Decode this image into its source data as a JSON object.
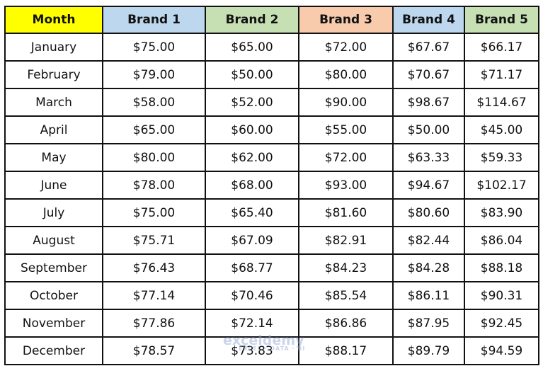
{
  "colors": {
    "month_header": "#ffff00",
    "brand1": "#bdd7ee",
    "brand2": "#c6e0b4",
    "brand3": "#f8cbad",
    "brand4": "#bdd7ee",
    "brand5": "#c6e0b4"
  },
  "headers": [
    "Month",
    "Brand 1",
    "Brand 2",
    "Brand 3",
    "Brand 4",
    "Brand 5"
  ],
  "rows": [
    [
      "January",
      "$75.00",
      "$65.00",
      "$72.00",
      "$67.67",
      "$66.17"
    ],
    [
      "February",
      "$79.00",
      "$50.00",
      "$80.00",
      "$70.67",
      "$71.17"
    ],
    [
      "March",
      "$58.00",
      "$52.00",
      "$90.00",
      "$98.67",
      "$114.67"
    ],
    [
      "April",
      "$65.00",
      "$60.00",
      "$55.00",
      "$50.00",
      "$45.00"
    ],
    [
      "May",
      "$80.00",
      "$62.00",
      "$72.00",
      "$63.33",
      "$59.33"
    ],
    [
      "June",
      "$78.00",
      "$68.00",
      "$93.00",
      "$94.67",
      "$102.17"
    ],
    [
      "July",
      "$75.00",
      "$65.40",
      "$81.60",
      "$80.60",
      "$83.90"
    ],
    [
      "August",
      "$75.71",
      "$67.09",
      "$82.91",
      "$82.44",
      "$86.04"
    ],
    [
      "September",
      "$76.43",
      "$68.77",
      "$84.23",
      "$84.28",
      "$88.18"
    ],
    [
      "October",
      "$77.14",
      "$70.46",
      "$85.54",
      "$86.11",
      "$90.31"
    ],
    [
      "November",
      "$77.86",
      "$72.14",
      "$86.86",
      "$87.95",
      "$92.45"
    ],
    [
      "December",
      "$78.57",
      "$73.83",
      "$88.17",
      "$89.79",
      "$94.59"
    ]
  ],
  "watermark": {
    "name": "exceldemy",
    "tagline": "EXCEL · DATA · BI"
  }
}
